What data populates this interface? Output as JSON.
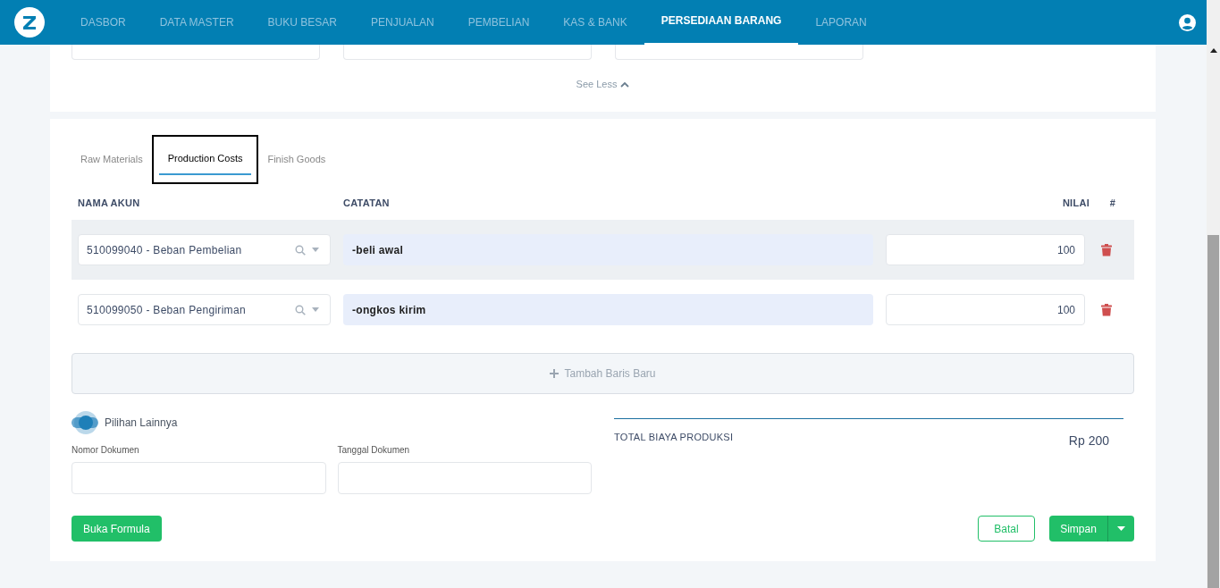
{
  "nav": {
    "items": [
      {
        "label": "DASBOR",
        "selected": false
      },
      {
        "label": "DATA MASTER",
        "selected": false
      },
      {
        "label": "BUKU BESAR",
        "selected": false
      },
      {
        "label": "PENJUALAN",
        "selected": false
      },
      {
        "label": "PEMBELIAN",
        "selected": false
      },
      {
        "label": "KAS & BANK",
        "selected": false
      },
      {
        "label": "PERSEDIAAN BARANG",
        "selected": true
      },
      {
        "label": "LAPORAN",
        "selected": false
      }
    ]
  },
  "top_section": {
    "see_less": "See Less"
  },
  "tabs": [
    {
      "label": "Raw Materials",
      "selected": false
    },
    {
      "label": "Production Costs",
      "selected": true
    },
    {
      "label": "Finish Goods",
      "selected": false
    }
  ],
  "table": {
    "columns": [
      "NAMA AKUN",
      "CATATAN",
      "NILAI",
      "#"
    ],
    "rows": [
      {
        "account": "510099040 - Beban Pembelian",
        "note": "-beli awal",
        "value": "100",
        "selected": true
      },
      {
        "account": "510099050 - Beban Pengiriman",
        "note": "-ongkos kirim",
        "value": "100",
        "selected": false
      }
    ]
  },
  "add_row": "Tambah Baris Baru",
  "other_options": {
    "label": "Pilihan Lainnya",
    "on": true
  },
  "fields": [
    {
      "label": "Nomor Dokumen"
    },
    {
      "label": "Tanggal Dokumen"
    }
  ],
  "total": {
    "label": "TOTAL BIAYA PRODUKSI",
    "value": "Rp 200"
  },
  "buttons": {
    "open_formula": "Buka Formula",
    "cancel": "Batal",
    "save": "Simpan"
  }
}
